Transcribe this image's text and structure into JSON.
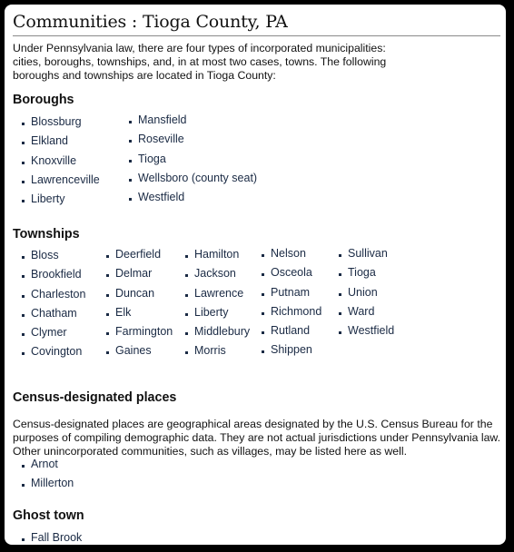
{
  "title": "Communities : Tioga County, PA",
  "intro": "Under Pennsylvania law, there are four types of incorporated municipalities: cities, boroughs, townships, and, in at most two cases, towns. The following boroughs and townships are located in Tioga County:",
  "boroughs": {
    "heading": "Boroughs",
    "columns": [
      [
        "Blossburg",
        "Elkland",
        "Knoxville",
        "Lawrenceville",
        "Liberty"
      ],
      [
        "Mansfield",
        "Roseville",
        "Tioga",
        "Wellsboro (county seat)",
        "Westfield"
      ]
    ]
  },
  "townships": {
    "heading": "Townships",
    "columns": [
      [
        "Bloss",
        "Brookfield",
        "Charleston",
        "Chatham",
        "Clymer",
        "Covington"
      ],
      [
        "Deerfield",
        "Delmar",
        "Duncan",
        "Elk",
        "Farmington",
        "Gaines"
      ],
      [
        "Hamilton",
        "Jackson",
        "Lawrence",
        "Liberty",
        "Middlebury",
        "Morris"
      ],
      [
        "Nelson",
        "Osceola",
        "Putnam",
        "Richmond",
        "Rutland",
        "Shippen"
      ],
      [
        "Sullivan",
        "Tioga",
        "Union",
        "Ward",
        "Westfield"
      ]
    ]
  },
  "cdp": {
    "heading": "Census-designated places",
    "text": "Census-designated places are geographical areas designated by the U.S. Census Bureau for the purposes of compiling demographic data. They are not actual jurisdictions under Pennsylvania law. Other unincorporated communities, such as villages, may be listed here as well.",
    "items": [
      "Arnot",
      "Millerton"
    ]
  },
  "ghost": {
    "heading": "Ghost town",
    "items": [
      "Fall Brook"
    ]
  }
}
